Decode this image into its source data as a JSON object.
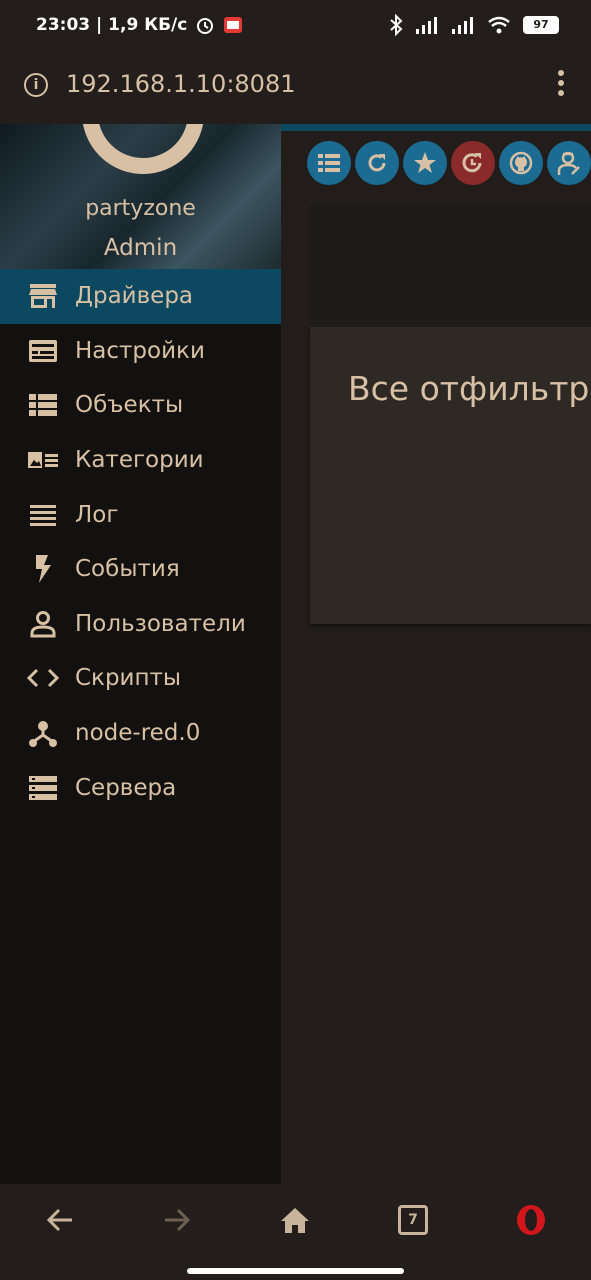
{
  "status_bar": {
    "time_speed": "23:03 | 1,9 КБ/с",
    "battery": "97"
  },
  "browser": {
    "url": "192.168.1.10:8081",
    "tabs_count": "7"
  },
  "sidebar": {
    "user_name": "partyzone",
    "user_role": "Admin",
    "items": [
      {
        "label": "Драйвера",
        "icon": "store-icon",
        "active": true
      },
      {
        "label": "Настройки",
        "icon": "settings-input-icon"
      },
      {
        "label": "Объекты",
        "icon": "list-icon"
      },
      {
        "label": "Категории",
        "icon": "category-card-icon"
      },
      {
        "label": "Лог",
        "icon": "log-lines-icon"
      },
      {
        "label": "События",
        "icon": "flash-icon"
      },
      {
        "label": "Пользователи",
        "icon": "person-icon"
      },
      {
        "label": "Скрипты",
        "icon": "code-icon"
      },
      {
        "label": "node-red.0",
        "icon": "node-tree-icon"
      },
      {
        "label": "Сервера",
        "icon": "server-icon"
      }
    ]
  },
  "toolbar": {
    "buttons": [
      "list-icon",
      "refresh-icon",
      "star-icon",
      "update-history-icon",
      "github-icon",
      "expert-user-icon"
    ]
  },
  "main": {
    "card_title": "Все отфильтро"
  },
  "colors": {
    "accent": "#0c4860",
    "button": "#1b6b93",
    "text": "#d7c0a4",
    "sidebar_bg": "#131110"
  }
}
